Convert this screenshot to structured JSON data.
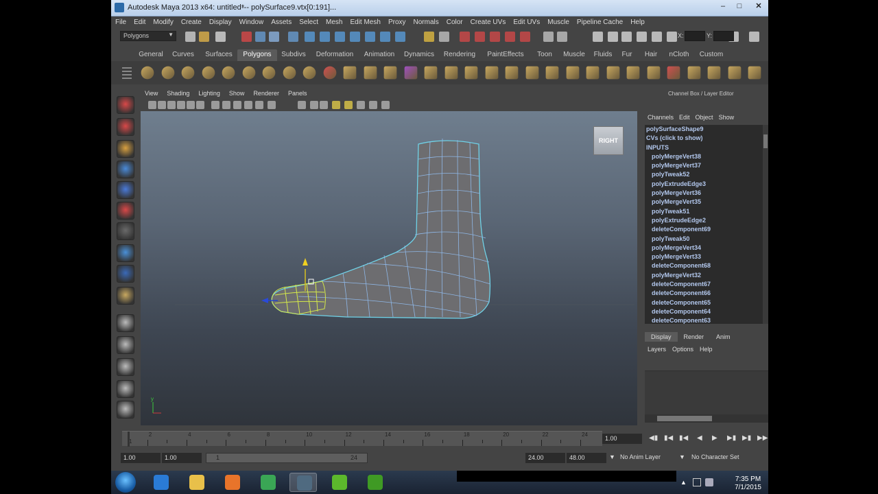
{
  "window": {
    "title": "Autodesk Maya 2013 x64: untitled*",
    "selection": "---    polySurface9.vtx[0:191]...",
    "controls": [
      "minimize-icon",
      "maximize-icon",
      "close-icon"
    ]
  },
  "menubar": [
    "File",
    "Edit",
    "Modify",
    "Create",
    "Display",
    "Window",
    "Assets",
    "Select",
    "Mesh",
    "Edit Mesh",
    "Proxy",
    "Normals",
    "Color",
    "Create UVs",
    "Edit UVs",
    "Muscle",
    "Pipeline Cache",
    "Help"
  ],
  "statusline": {
    "mode": "Polygons",
    "x_label": "X:",
    "y_label": "Y:"
  },
  "shelf_tabs": [
    {
      "label": "General",
      "w": 44
    },
    {
      "label": "Curves",
      "w": 50
    },
    {
      "label": "Surfaces",
      "w": 54
    },
    {
      "label": "Polygons",
      "w": 58,
      "active": true
    },
    {
      "label": "Subdivs",
      "w": 48
    },
    {
      "label": "Deformation",
      "w": 72
    },
    {
      "label": "Animation",
      "w": 58
    },
    {
      "label": "Dynamics",
      "w": 58
    },
    {
      "label": "Rendering",
      "w": 60
    },
    {
      "label": "PaintEffects",
      "w": 74
    },
    {
      "label": "Toon",
      "w": 40
    },
    {
      "label": "Muscle",
      "w": 46
    },
    {
      "label": "Fluids",
      "w": 38
    },
    {
      "label": "Fur",
      "w": 32
    },
    {
      "label": "Hair",
      "w": 38
    },
    {
      "label": "nCloth",
      "w": 44
    },
    {
      "label": "Custom",
      "w": 50
    }
  ],
  "viewport": {
    "menu": [
      "View",
      "Shading",
      "Lighting",
      "Show",
      "Renderer",
      "Panels"
    ],
    "view_cube": "RIGHT",
    "axis_y": "y"
  },
  "channel_box": {
    "title": "Channel Box / Layer Editor",
    "menu": [
      "Channels",
      "Edit",
      "Object",
      "Show"
    ],
    "items": [
      {
        "label": "polySurfaceShape9",
        "level": 0
      },
      {
        "label": "CVs (click to show)",
        "level": 0
      },
      {
        "label": "INPUTS",
        "level": 0
      },
      {
        "label": "polyMergeVert38",
        "level": 1
      },
      {
        "label": "polyMergeVert37",
        "level": 1
      },
      {
        "label": "polyTweak52",
        "level": 1
      },
      {
        "label": "polyExtrudeEdge3",
        "level": 1
      },
      {
        "label": "polyMergeVert36",
        "level": 1
      },
      {
        "label": "polyMergeVert35",
        "level": 1
      },
      {
        "label": "polyTweak51",
        "level": 1
      },
      {
        "label": "polyExtrudeEdge2",
        "level": 1
      },
      {
        "label": "deleteComponent69",
        "level": 1
      },
      {
        "label": "polyTweak50",
        "level": 1
      },
      {
        "label": "polyMergeVert34",
        "level": 1
      },
      {
        "label": "polyMergeVert33",
        "level": 1
      },
      {
        "label": "deleteComponent68",
        "level": 1
      },
      {
        "label": "polyMergeVert32",
        "level": 1
      },
      {
        "label": "deleteComponent67",
        "level": 1
      },
      {
        "label": "deleteComponent66",
        "level": 1
      },
      {
        "label": "deleteComponent65",
        "level": 1
      },
      {
        "label": "deleteComponent64",
        "level": 1
      },
      {
        "label": "deleteComponent63",
        "level": 1
      }
    ]
  },
  "layer_editor": {
    "tabs": [
      "Display",
      "Render",
      "Anim"
    ],
    "active_tab": "Display",
    "menu": [
      "Layers",
      "Options",
      "Help"
    ]
  },
  "timeline": {
    "start": 1,
    "end": 24,
    "labels": [
      1,
      2,
      4,
      6,
      8,
      10,
      12,
      14,
      16,
      18,
      20,
      22,
      24
    ],
    "current_frame": "1.00"
  },
  "range": {
    "start_time": "1.00",
    "playback_start": "1.00",
    "slider_start": "1",
    "slider_end": "24",
    "playback_end": "24.00",
    "end_time": "48.00",
    "anim_layer": "No Anim Layer",
    "character_set": "No Character Set"
  },
  "taskbar": {
    "apps": [
      {
        "name": "ie-icon",
        "color": "#2a7bd6"
      },
      {
        "name": "folder-icon",
        "color": "#e8c04a"
      },
      {
        "name": "media-player-icon",
        "color": "#e8742a"
      },
      {
        "name": "chrome-icon",
        "color": "#3aa655"
      },
      {
        "name": "maya-icon",
        "color": "#4f6a80",
        "active": true
      },
      {
        "name": "camtasia-icon",
        "color": "#5cb82c"
      },
      {
        "name": "camtasia-recorder-icon",
        "color": "#3f9a24"
      }
    ],
    "time": "7:35 PM",
    "date": "7/1/2015"
  }
}
